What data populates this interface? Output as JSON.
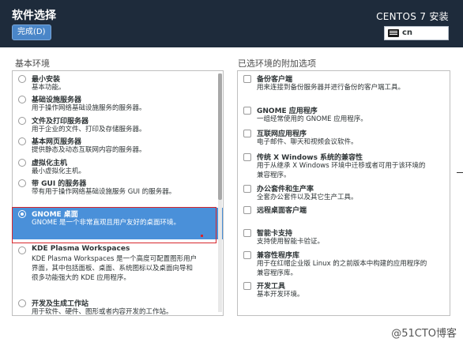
{
  "header": {
    "title": "软件选择",
    "done_label": "完成(D)",
    "product": "CENTOS 7 安装",
    "keyboard_value": "cn"
  },
  "left": {
    "title": "基本环境",
    "items": [
      {
        "name": "最小安装",
        "desc": [
          "基本功能。"
        ]
      },
      {
        "name": "基础设施服务器",
        "desc": [
          "用于操作网络基础设施服务的服务器。"
        ]
      },
      {
        "name": "文件及打印服务器",
        "desc": [
          "用于企业的文件、打印及存储服务器。"
        ]
      },
      {
        "name": "基本网页服务器",
        "desc": [
          "提供静态及动态互联网内容的服务器。"
        ]
      },
      {
        "name": "虚拟化主机",
        "desc": [
          "最小虚拟化主机。"
        ]
      },
      {
        "name": "带 GUI 的服务器",
        "desc": [
          "带有用于操作网络基础设施服务 GUI 的服务器。"
        ]
      },
      {
        "name": "GNOME 桌面",
        "desc": [
          "GNOME 是一个非常直观且用户友好的桌面环境。"
        ],
        "selected": true
      },
      {
        "name": "KDE Plasma Workspaces",
        "desc": [
          "KDE Plasma Workspaces 是一个高度可配置图形用户",
          "界面，其中包括面板、桌面、系统图标以及桌面向导和",
          "很多功能强大的 KDE 应用程序。"
        ]
      },
      {
        "name": "开发及生成工作站",
        "desc": [
          "用于软件、硬件、图形或者内容开发的工作站。"
        ]
      }
    ]
  },
  "right": {
    "title": "已选环境的附加选项",
    "items": [
      {
        "name": "备份客户端",
        "desc": [
          "用来连接到备份服务器并进行备份的客户端工具。"
        ]
      },
      {
        "name": "GNOME 应用程序",
        "desc": [
          "一组经常使用的 GNOME 应用程序。"
        ]
      },
      {
        "name": "互联网应用程序",
        "desc": [
          "电子邮件、聊天和视频会议软件。"
        ]
      },
      {
        "name": "传统 X Windows 系统的兼容性",
        "desc": [
          "用于从继承 X Windows 环境中迁移或者可用于该环境的",
          "兼容程序。"
        ]
      },
      {
        "name": "办公套件和生产率",
        "desc": [
          "全套办公套件以及其它生产工具。"
        ]
      },
      {
        "name": "远程桌面客户端",
        "desc": []
      },
      {
        "name": "智能卡支持",
        "desc": [
          "支持使用智能卡验证。"
        ]
      },
      {
        "name": "兼容性程序库",
        "desc": [
          "用于在红帽企业版 Linux 的之前版本中构建的应用程序的",
          "兼容程序库。"
        ]
      },
      {
        "name": "开发工具",
        "desc": [
          "基本开发环境。"
        ]
      }
    ]
  },
  "watermark": "@51CTO博客",
  "colors": {
    "header_bg": "#1e2b3b",
    "accent": "#4a90d9",
    "highlight_border": "#d8262c"
  }
}
